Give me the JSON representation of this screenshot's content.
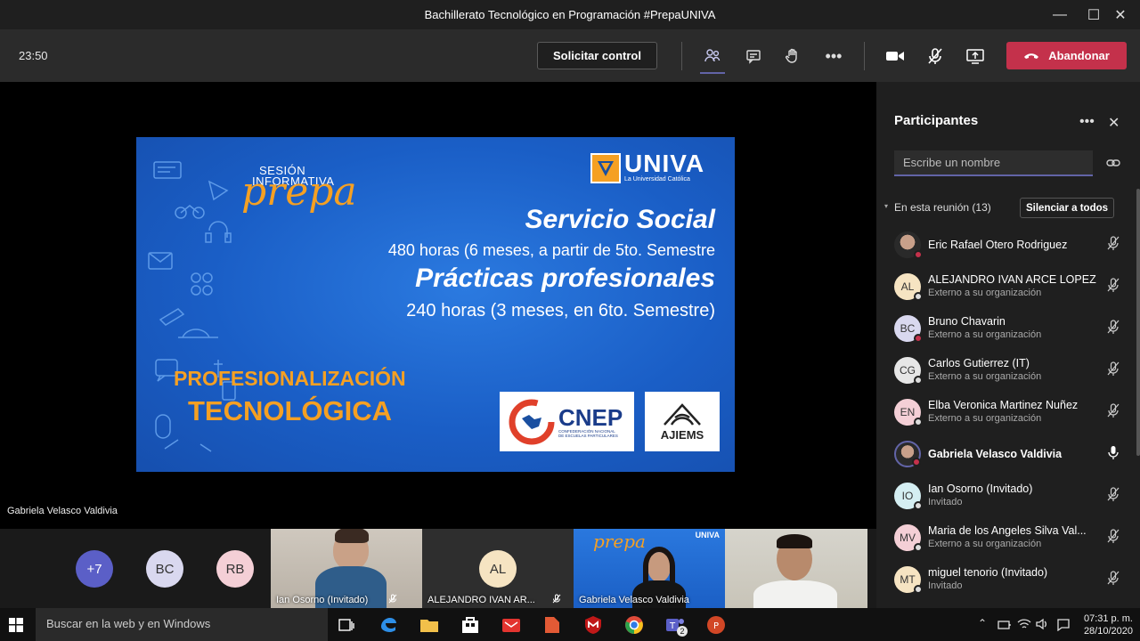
{
  "window": {
    "title": "Bachillerato Tecnológico en Programación #PrepaUNIVA"
  },
  "topbar": {
    "timer": "23:50",
    "request_control": "Solicitar control",
    "leave": "Abandonar"
  },
  "slide": {
    "sesion": "SESIÓN",
    "informativa": "INFORMATIVA",
    "prepa": "prepa",
    "brand": "UNIVA",
    "brand_sub": "La Universidad Católica",
    "h1": "Servicio Social",
    "l1": "480 horas (6 meses, a partir de 5to. Semestre",
    "h2": "Prácticas profesionales",
    "l2": "240 horas (3 meses, en 6to. Semestre)",
    "prof1": "PROFESIONALIZACIÓN",
    "prof2": "TECNOLÓGICA",
    "cnep": "CNEP",
    "cnep_sub": "CONFEDERACIÓN NACIONAL DE ESCUELAS PARTICULARES",
    "ajiems": "AJIEMS"
  },
  "stage": {
    "presenter": "Gabriela Velasco Valdivia"
  },
  "strip": {
    "more": "+7",
    "c1": "BC",
    "c2": "RB",
    "tiles": [
      {
        "name": "Ian Osorno (Invitado)"
      },
      {
        "name": "ALEJANDRO IVAN AR...",
        "initials": "AL"
      },
      {
        "name": "Gabriela Velasco Valdivia",
        "brand": "UNIVA",
        "prepa": "prepa"
      },
      {
        "name": ""
      }
    ]
  },
  "panel": {
    "title": "Participantes",
    "search_placeholder": "Escribe un nombre",
    "in_meeting": "En esta reunión (13)",
    "mute_all": "Silenciar a todos",
    "participants": [
      {
        "initials": "",
        "name": "Eric Rafael Otero Rodriguez",
        "sub": ""
      },
      {
        "initials": "AL",
        "name": "ALEJANDRO IVAN ARCE LOPEZ",
        "sub": "Externo a su organización"
      },
      {
        "initials": "BC",
        "name": "Bruno Chavarin",
        "sub": "Externo a su organización"
      },
      {
        "initials": "CG",
        "name": "Carlos Gutierrez (IT)",
        "sub": "Externo a su organización"
      },
      {
        "initials": "EN",
        "name": "Elba Veronica Martinez Nuñez",
        "sub": "Externo a su organización"
      },
      {
        "initials": "",
        "name": "Gabriela Velasco Valdivia",
        "sub": ""
      },
      {
        "initials": "IO",
        "name": "Ian Osorno (Invitado)",
        "sub": "Invitado"
      },
      {
        "initials": "MV",
        "name": "Maria de los Angeles Silva Val...",
        "sub": "Externo a su organización"
      },
      {
        "initials": "MT",
        "name": "miguel tenorio (Invitado)",
        "sub": "Invitado"
      }
    ]
  },
  "taskbar": {
    "search": "Buscar en la web y en Windows",
    "teams_badge": "2",
    "time": "07:31 p. m.",
    "date": "28/10/2020"
  },
  "colors": {
    "accent": "#6264a7",
    "leave": "#c4314b",
    "slide_orange": "#f5a023"
  }
}
